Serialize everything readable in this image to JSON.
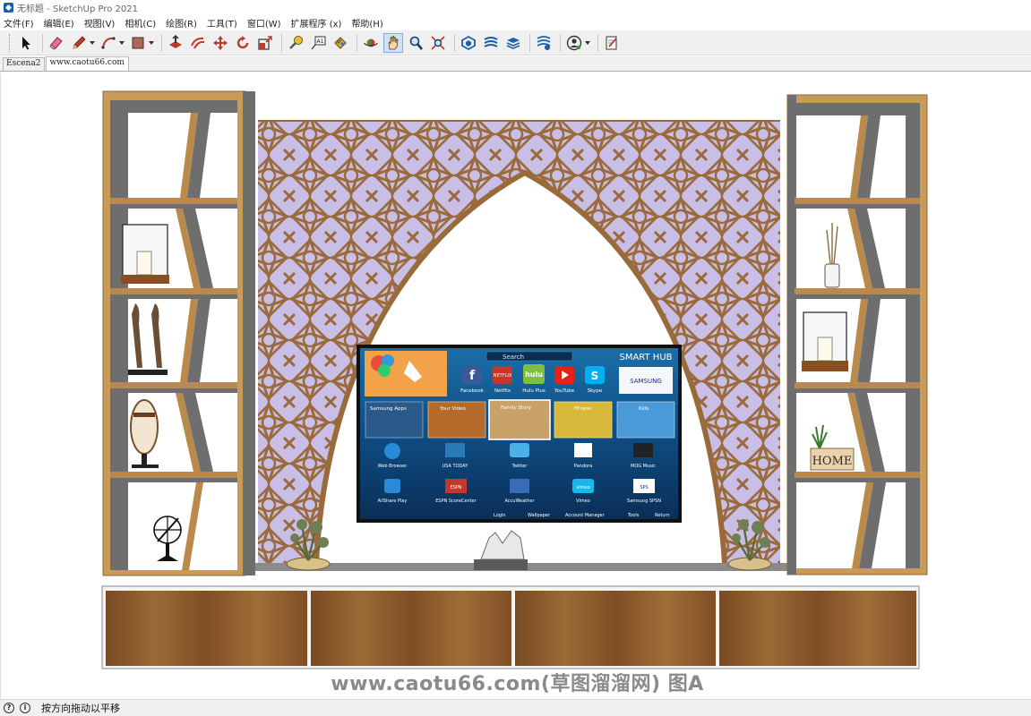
{
  "window": {
    "title": "无标题 - SketchUp Pro 2021"
  },
  "menu": {
    "items": [
      "文件(F)",
      "编辑(E)",
      "视图(V)",
      "相机(C)",
      "绘图(R)",
      "工具(T)",
      "窗口(W)",
      "扩展程序 (x)",
      "帮助(H)"
    ]
  },
  "toolbar": {
    "buttons": [
      {
        "name": "select-icon"
      },
      {
        "name": "eraser-icon"
      },
      {
        "name": "pencil-icon"
      },
      {
        "name": "arc-icon"
      },
      {
        "name": "rectangle-icon"
      },
      {
        "name": "push-pull-icon"
      },
      {
        "name": "offset-icon"
      },
      {
        "name": "move-icon"
      },
      {
        "name": "rotate-icon"
      },
      {
        "name": "scale-icon"
      },
      {
        "name": "tape-measure-icon"
      },
      {
        "name": "text-icon"
      },
      {
        "name": "paint-bucket-icon"
      },
      {
        "name": "orbit-icon"
      },
      {
        "name": "pan-icon"
      },
      {
        "name": "zoom-icon"
      },
      {
        "name": "zoom-extents-icon"
      },
      {
        "name": "warehouse-icon"
      },
      {
        "name": "extension-warehouse-icon"
      },
      {
        "name": "layout-icon"
      },
      {
        "name": "extension-manager-icon"
      },
      {
        "name": "user-account-icon"
      },
      {
        "name": "send-feedback-icon"
      }
    ],
    "active": "pan-icon",
    "text_tool_label": "A1"
  },
  "tabs": [
    {
      "label": "Escena2",
      "selected": false
    },
    {
      "label": "www.caotu66.com",
      "selected": true
    }
  ],
  "scene": {
    "tv": {
      "brand_header": "SMART HUB",
      "search_label": "Search",
      "apps_row1": [
        "Facebook",
        "Netflix",
        "Hulu Plus",
        "YouTube",
        "Skype"
      ],
      "samsung_logo": "SAMSUNG",
      "panels": [
        "Samsung Apps",
        "Your Video",
        "Family Story",
        "Fitness",
        "Kids"
      ],
      "apps_row3": [
        "Web Browser",
        "USA TODAY",
        "Twitter",
        "Pandora",
        "MOG Music"
      ],
      "apps_row4": [
        "AllShare Play",
        "ESPN ScoreCenter",
        "AccuWeather",
        "Vimeo",
        "Samsung SPSN"
      ],
      "footer": [
        "Login",
        "Wallpaper",
        "Account Manager",
        "Tools",
        "Return"
      ],
      "hulu_badge": "hulu",
      "netflix_badge": "NETFLIX",
      "espn_badge": "ESPN",
      "vimeo_badge": "vimeo",
      "sports_badge": "SPS"
    },
    "home_sign": "HOME",
    "watermark": "www.caotu66.com(草图溜溜网) 图A"
  },
  "colors": {
    "wood_frame": "#b98a4c",
    "lattice": "#9a6a3a",
    "lattice_fill": "#c9bfe6",
    "shelf_gray": "#6e6e6e",
    "cabinet_wood": "#8a5a2c",
    "tv_bg": "#0e3f6e"
  },
  "statusbar": {
    "message": "按方向拖动以平移"
  }
}
